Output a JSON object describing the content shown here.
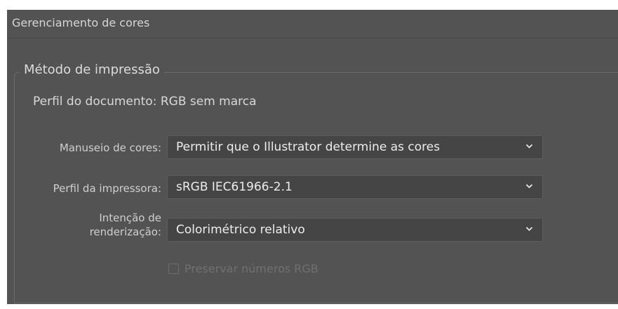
{
  "panel": {
    "title": "Gerenciamento de cores"
  },
  "print_method": {
    "group_title": "Método de impressão",
    "document_profile": "Perfil do documento: RGB sem marca"
  },
  "color_handling": {
    "label": "Manuseio de cores:",
    "value": "Permitir que o Illustrator determine as cores"
  },
  "printer_profile": {
    "label": "Perfil da impressora:",
    "value": "sRGB IEC61966-2.1"
  },
  "rendering_intent": {
    "label_line1": "Intenção de",
    "label_line2": "renderização:",
    "value": "Colorimétrico relativo"
  },
  "preserve_rgb": {
    "label": "Preservar números RGB",
    "checked": false,
    "enabled": false
  },
  "icons": {
    "dropdown": "chevron-down-icon",
    "checkbox": "checkbox-unchecked-icon"
  }
}
